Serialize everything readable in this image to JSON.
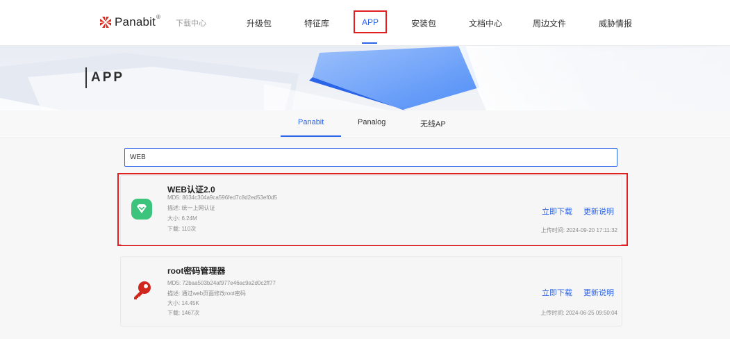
{
  "header": {
    "brand": "Panabit",
    "brand_mark": "®",
    "subtitle": "下载中心",
    "nav": [
      "升级包",
      "特征库",
      "APP",
      "安装包",
      "文档中心",
      "周边文件",
      "威胁情报"
    ]
  },
  "banner": {
    "title": "APP"
  },
  "tabs": [
    "Panabit",
    "Panalog",
    "无线AP"
  ],
  "search": {
    "value": "WEB"
  },
  "cards": [
    {
      "name": "WEB认证2.0",
      "md5": "MD5: 8634c304a9ca596fed7c8d2ed53ef0d5",
      "desc": "描述: 统一上网认证",
      "size": "大小: 6.24M",
      "downloads": "下载: 110次",
      "download_label": "立即下载",
      "notes_label": "更新说明",
      "upload_time": "上传时间: 2024-09-20 17:11:32",
      "icon": "shield-check-icon",
      "icon_color": "#3cc47c"
    },
    {
      "name": "root密码管理器",
      "md5": "MD5: 72baa503b24af977e46ac9a2d0c2ff77",
      "desc": "描述: 通过web页面修改root密码",
      "size": "大小: 14.45K",
      "downloads": "下载: 1467次",
      "download_label": "立即下载",
      "notes_label": "更新说明",
      "upload_time": "上传时间: 2024-06-25 09:50:04",
      "icon": "key-icon",
      "icon_color": "#d0261c"
    }
  ],
  "colors": {
    "accent": "#2a64e8",
    "highlight": "#e02020"
  }
}
